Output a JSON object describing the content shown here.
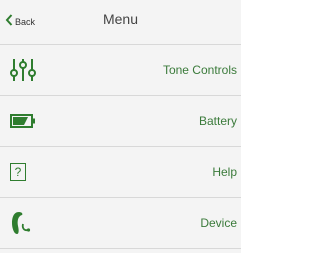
{
  "header": {
    "back_label": "Back",
    "title": "Menu"
  },
  "menu": {
    "items": [
      {
        "label": "Tone Controls",
        "icon": "sliders-icon"
      },
      {
        "label": "Battery",
        "icon": "battery-icon"
      },
      {
        "label": "Help",
        "icon": "help-icon",
        "icon_text": "?"
      },
      {
        "label": "Device",
        "icon": "hearing-aid-icon"
      }
    ]
  },
  "colors": {
    "accent": "#2f7d2f",
    "label": "#3a7a3a",
    "background": "#f4f4f4",
    "divider": "#d8d8d8"
  }
}
